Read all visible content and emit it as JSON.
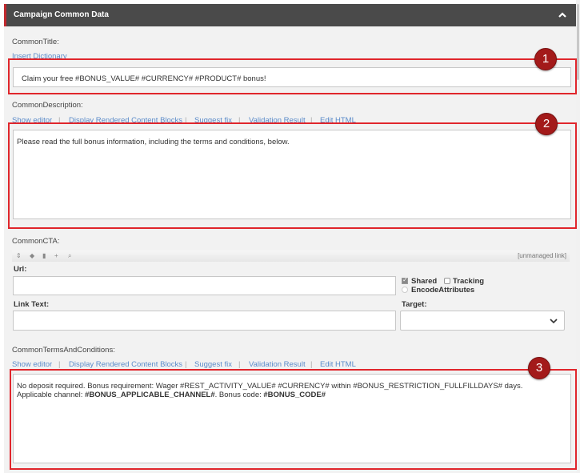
{
  "header": {
    "title": "Campaign Common Data",
    "chevron_icon": "chevron-up-icon"
  },
  "title_field": {
    "label": "CommonTitle:",
    "insert_dictionary": "Insert Dictionary",
    "value": "Claim your free #BONUS_VALUE# #CURRENCY# #PRODUCT# bonus!"
  },
  "description_field": {
    "label": "CommonDescription:",
    "links": [
      "Show editor",
      "Display Rendered Content Blocks",
      "Suggest fix",
      "Validation Result",
      "Edit HTML"
    ],
    "value": "Please read the full bonus information, including the terms and conditions, below."
  },
  "cta": {
    "label": "CommonCTA:",
    "toolbar_icons": [
      "sort-icon",
      "tag-icon",
      "trash-icon",
      "plus-icon",
      "search-icon"
    ],
    "unmanaged": "[unmanaged link]",
    "url_label": "Url:",
    "url_value": "",
    "shared_label": "Shared",
    "shared_checked": true,
    "tracking_label": "Tracking",
    "tracking_checked": false,
    "encode_label": "EncodeAttributes",
    "encode_checked": false,
    "link_text_label": "Link Text:",
    "link_text_value": "",
    "target_label": "Target:",
    "target_value": ""
  },
  "terms_field": {
    "label": "CommonTermsAndConditions:",
    "links": [
      "Show editor",
      "Display Rendered Content Blocks",
      "Suggest fix",
      "Validation Result",
      "Edit HTML"
    ],
    "line1": "No deposit required. Bonus requirement: Wager #REST_ACTIVITY_VALUE# #CURRENCY# within #BONUS_RESTRICTION_FULLFILLDAYS# days.",
    "line2_prefix": "Applicable channel: ",
    "line2_channel": "#BONUS_APPLICABLE_CHANNEL#",
    "line2_mid": ". Bonus code: ",
    "line2_code": "#BONUS_CODE#"
  },
  "annotations": {
    "badge1": "1",
    "badge2": "2",
    "badge3": "3"
  },
  "colors": {
    "header_bg": "#4a4a4a",
    "accent_red": "#e0262c",
    "badge": "#a31a1a",
    "link": "#5b8bc9"
  }
}
